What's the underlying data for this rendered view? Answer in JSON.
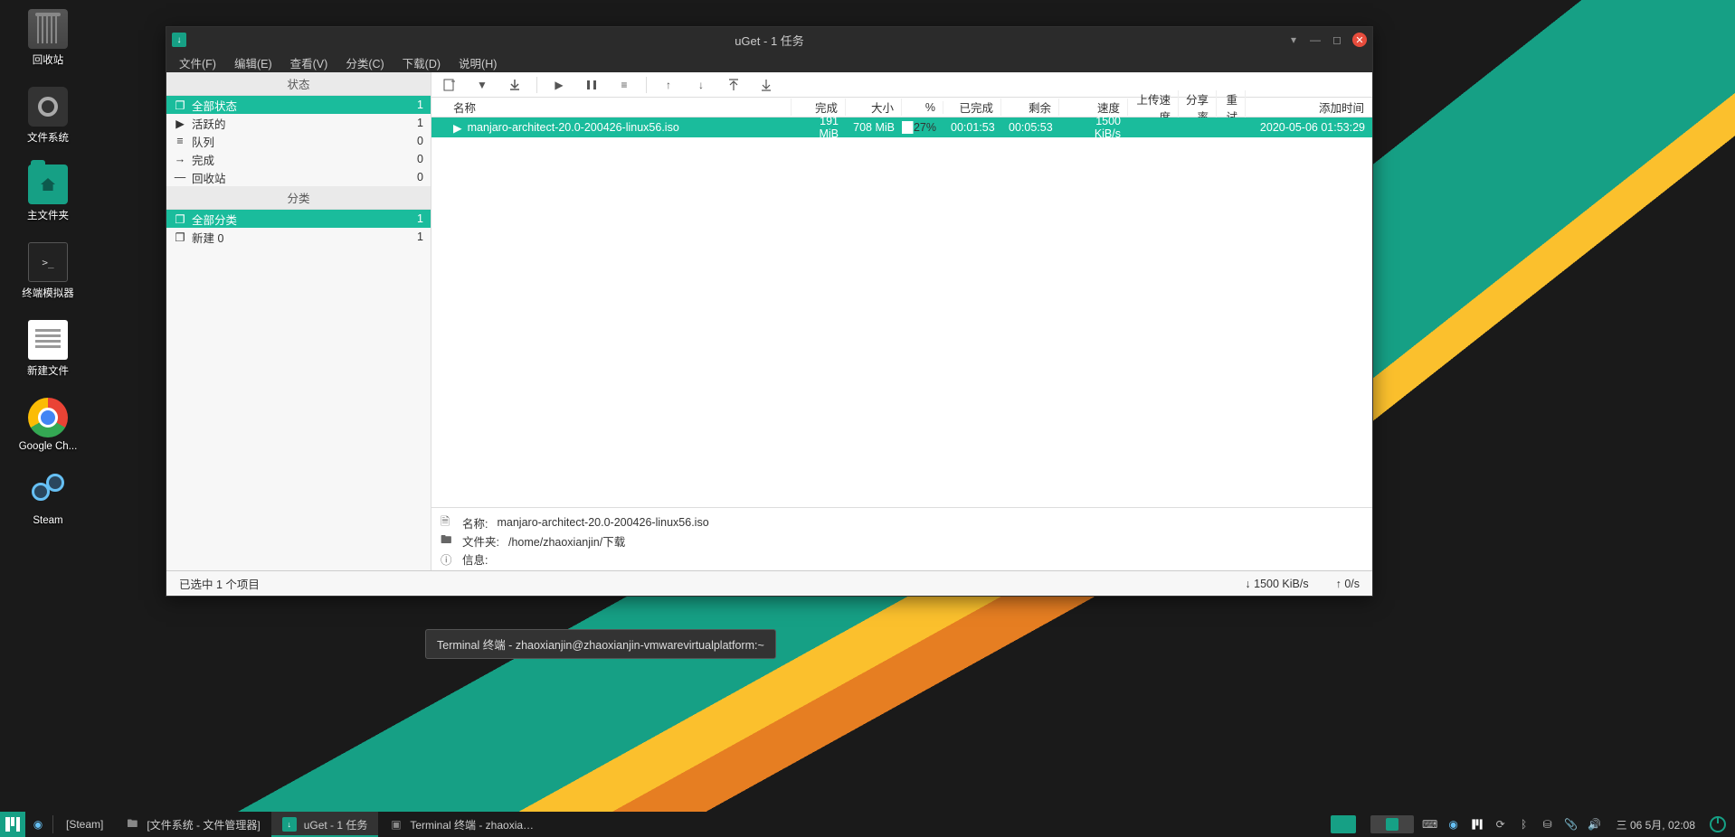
{
  "desktop": {
    "trash": "回收站",
    "filesystem": "文件系统",
    "home": "主文件夹",
    "terminal": "终端模拟器",
    "newfile": "新建文件",
    "chrome": "Google Ch...",
    "steam": "Steam"
  },
  "window": {
    "title": "uGet - 1 任务",
    "menu": {
      "file": "文件(F)",
      "edit": "编辑(E)",
      "view": "查看(V)",
      "category": "分类(C)",
      "download": "下载(D)",
      "help": "说明(H)"
    },
    "sidebar": {
      "status_header": "状态",
      "category_header": "分类",
      "status": [
        {
          "label": "全部状态",
          "count": "1",
          "selected": true,
          "icon": "copy"
        },
        {
          "label": "活跃的",
          "count": "1",
          "icon": "play"
        },
        {
          "label": "队列",
          "count": "0",
          "icon": "queue"
        },
        {
          "label": "完成",
          "count": "0",
          "icon": "arrow-r"
        },
        {
          "label": "回收站",
          "count": "0",
          "icon": "minus"
        }
      ],
      "categories": [
        {
          "label": "全部分类",
          "count": "1",
          "selected": true,
          "icon": "copy"
        },
        {
          "label": "新建 0",
          "count": "1",
          "icon": "copy"
        }
      ]
    },
    "columns": {
      "name": "名称",
      "done": "完成",
      "size": "大小",
      "pct": "%",
      "elapsed": "已完成",
      "remain": "剩余",
      "speed": "速度",
      "upspeed": "上传速度",
      "share": "分享率",
      "retry": "重试",
      "added": "添加时间"
    },
    "row": {
      "name": "manjaro-architect-20.0-200426-linux56.iso",
      "done": "191 MiB",
      "size": "708 MiB",
      "pct": "27%",
      "elapsed": "00:01:53",
      "remain": "00:05:53",
      "speed": "1500 KiB/s",
      "upspeed": "",
      "share": "",
      "retry": "",
      "added": "2020-05-06 01:53:29"
    },
    "details": {
      "name_label": "名称:",
      "name_value": "manjaro-architect-20.0-200426-linux56.iso",
      "folder_label": "文件夹:",
      "folder_value": "/home/zhaoxianjin/下载",
      "info_label": "信息:"
    },
    "statusbar": {
      "selection": "已选中 1 个项目",
      "down": "↓ 1500 KiB/s",
      "up": "↑ 0/s"
    }
  },
  "tooltip": "Terminal 终端 - zhaoxianjin@zhaoxianjin-vmwarevirtualplatform:~",
  "taskbar": {
    "items": [
      {
        "label": "[Steam]"
      },
      {
        "label": "[文件系统 - 文件管理器]"
      },
      {
        "label": "uGet - 1 任务",
        "active": true
      },
      {
        "label": "Terminal 终端 - zhaoxianjin..."
      }
    ],
    "clock": "三 06 5月, 02:08"
  }
}
